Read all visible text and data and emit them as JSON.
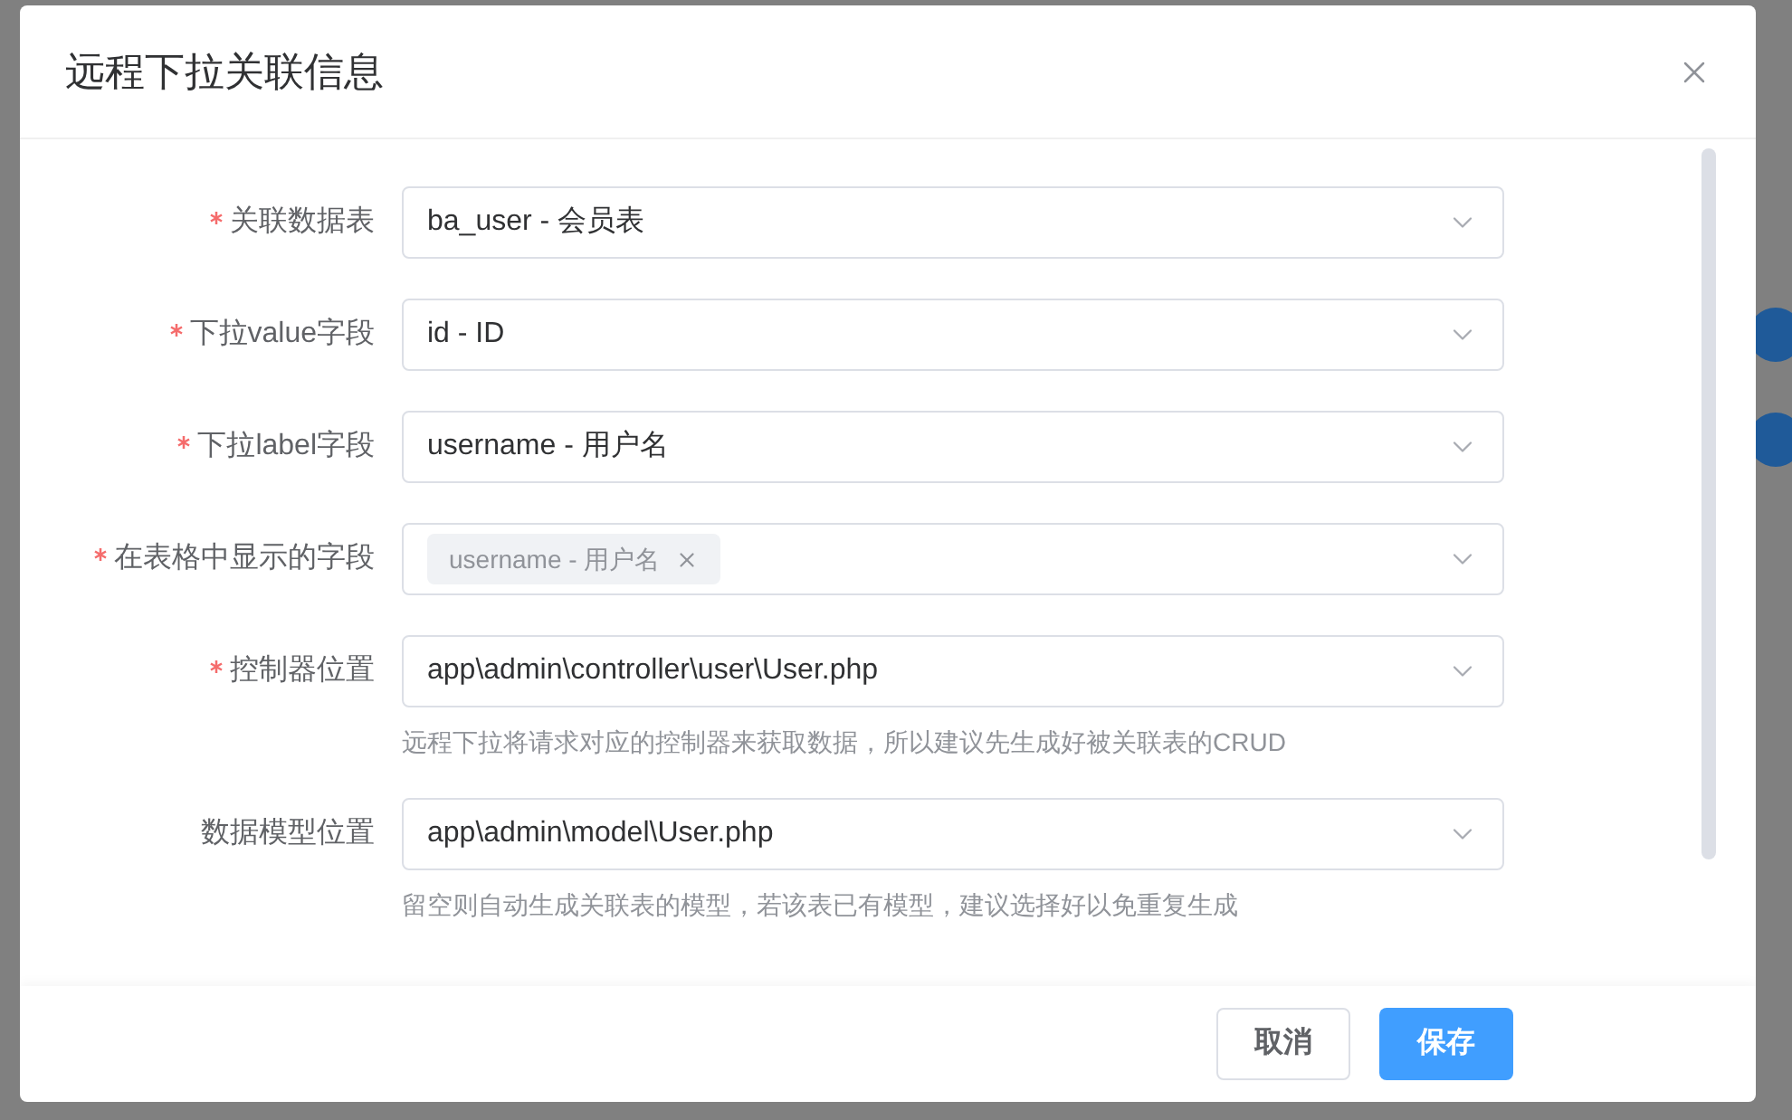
{
  "dialog": {
    "title": "远程下拉关联信息",
    "fields": [
      {
        "label": "关联数据表",
        "required": true,
        "kind": "select",
        "value": "ba_user - 会员表"
      },
      {
        "label": "下拉value字段",
        "required": true,
        "kind": "select",
        "value": "id - ID"
      },
      {
        "label": "下拉label字段",
        "required": true,
        "kind": "select",
        "value": "username - 用户名"
      },
      {
        "label": "在表格中显示的字段",
        "required": true,
        "kind": "tags",
        "tags": [
          "username - 用户名"
        ]
      },
      {
        "label": "控制器位置",
        "required": true,
        "kind": "select",
        "value": "app\\admin\\controller\\user\\User.php",
        "help": "远程下拉将请求对应的控制器来获取数据，所以建议先生成好被关联表的CRUD"
      },
      {
        "label": "数据模型位置",
        "required": false,
        "kind": "select",
        "value": "app\\admin\\model\\User.php",
        "help": "留空则自动生成关联表的模型，若该表已有模型，建议选择好以免重复生成"
      }
    ],
    "buttons": [
      {
        "label": "取消",
        "kind": "default"
      },
      {
        "label": "保存",
        "kind": "primary"
      }
    ]
  }
}
